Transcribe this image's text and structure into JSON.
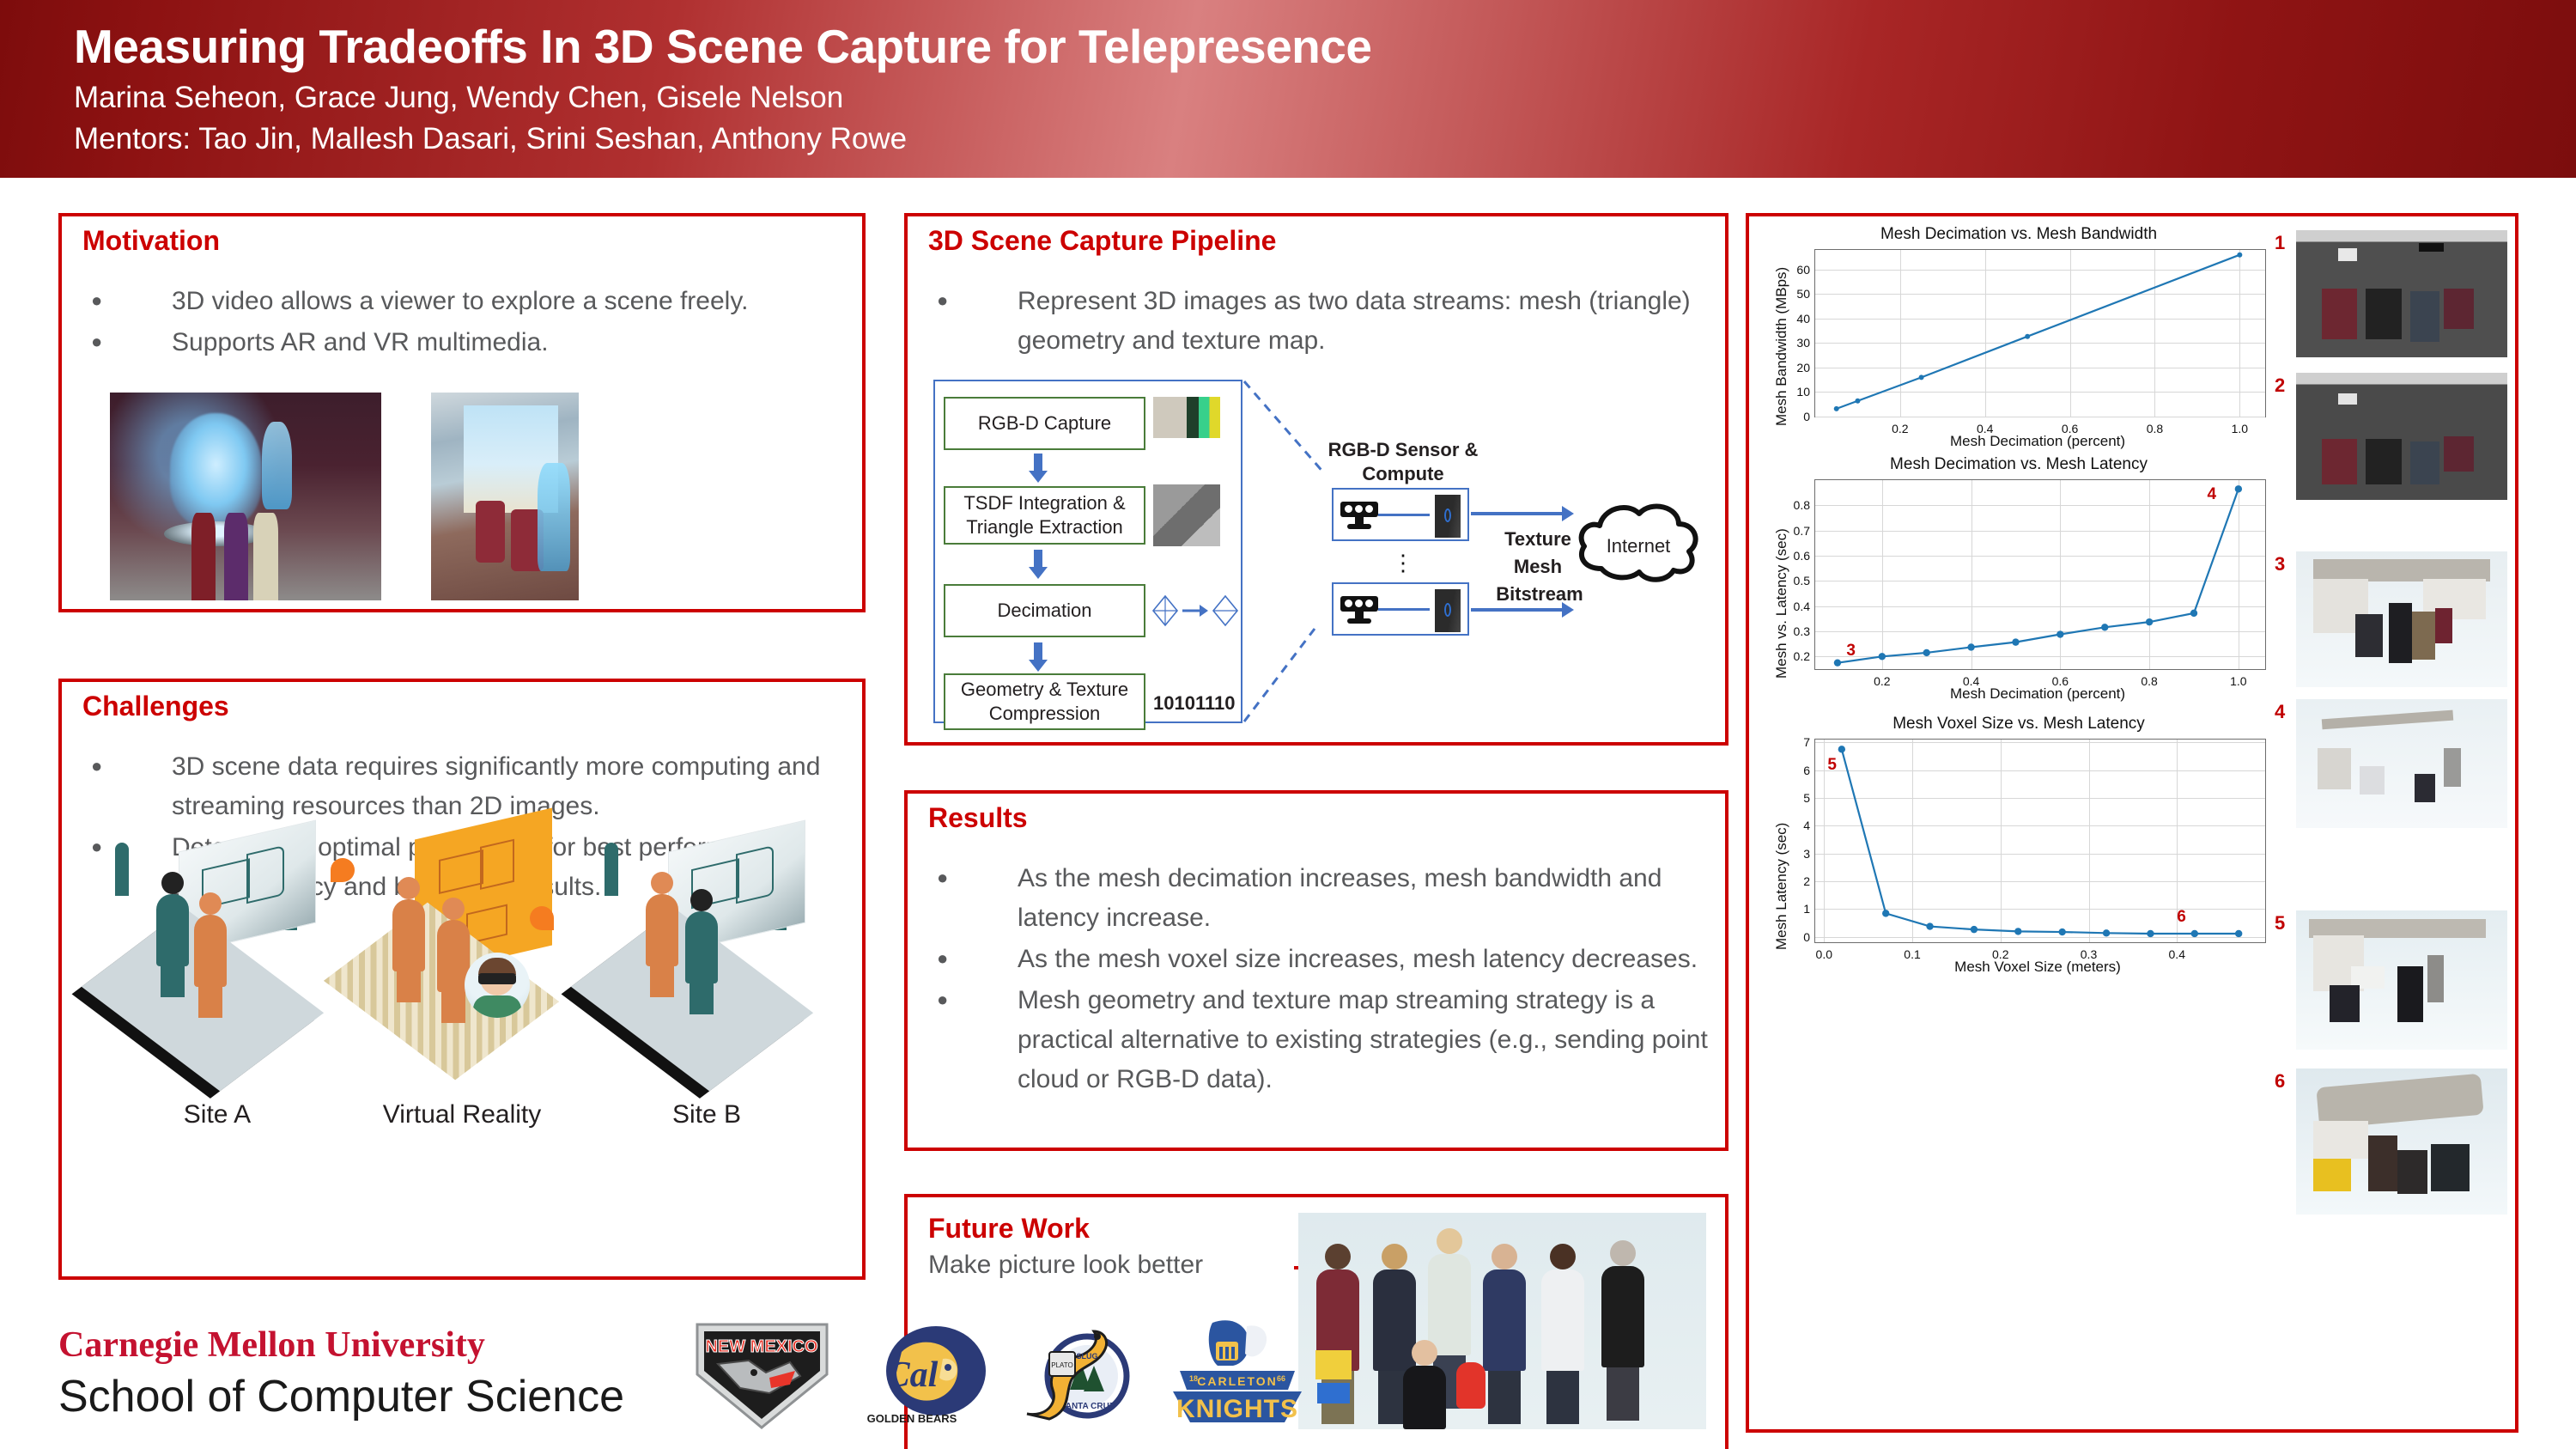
{
  "header": {
    "title": "Measuring Tradeoffs In 3D Scene Capture for Telepresence",
    "authors": "Marina Seheon, Grace Jung, Wendy Chen, Gisele Nelson",
    "mentors": "Mentors: Tao Jin, Mallesh Dasari, Srini Seshan, Anthony Rowe",
    "accent": "#cc0000",
    "gradient_from": "#7d0c0c",
    "gradient_to": "#d98080"
  },
  "motivation": {
    "title": "Motivation",
    "bullets": [
      "3D video allows a viewer to explore a scene freely.",
      "Supports AR and VR multimedia."
    ]
  },
  "challenges": {
    "title": "Challenges",
    "bullets": [
      "3D scene data requires significantly more computing and streaming resources than 2D images.",
      "Determining optimal parameters for best performance across latency and bandwidth results."
    ],
    "figure_labels": [
      "Site A",
      "Virtual Reality",
      "Site B"
    ]
  },
  "pipeline": {
    "title": "3D Scene Capture Pipeline",
    "bullets": [
      "Represent 3D images as two data streams: mesh (triangle) geometry and texture map."
    ],
    "steps": [
      "RGB-D Capture",
      "TSDF Integration & Triangle Extraction",
      "Decimation",
      "Geometry & Texture Compression"
    ],
    "bitstring": "10101110",
    "sensor_label": "RGB-D Sensor & Compute",
    "stream_label_1": "Texture",
    "stream_label_2": "Mesh",
    "stream_label_3": "Bitstream",
    "cloud_label": "Internet"
  },
  "results": {
    "title": "Results",
    "bullets": [
      "As the mesh decimation increases, mesh bandwidth and latency increase.",
      "As the mesh voxel size increases, mesh latency decreases.",
      "Mesh geometry and texture map streaming strategy is a practical alternative to existing strategies (e.g., sending point cloud or RGB-D data)."
    ]
  },
  "future_work": {
    "title": "Future Work",
    "text": "Make picture look better",
    "arrow": "right-arrow-icon"
  },
  "footer": {
    "cmu_line1": "Carnegie Mellon University",
    "cmu_line2": "School of Computer Science",
    "logos": [
      {
        "name": "new-mexico-lobos-logo",
        "caption": "NEW MEXICO"
      },
      {
        "name": "cal-golden-bears-logo",
        "caption": "GOLDEN BEARS",
        "word": "Cal"
      },
      {
        "name": "uc-santa-cruz-banana-slugs-logo",
        "caption": "SANTA CRUZ",
        "word": "SLUG"
      },
      {
        "name": "carleton-knights-logo",
        "caption": "KNIGHTS",
        "word": "CARLETON",
        "years": [
          "18",
          "66"
        ]
      }
    ]
  },
  "screenshots": [
    {
      "num": "1"
    },
    {
      "num": "2"
    },
    {
      "num": "3"
    },
    {
      "num": "4"
    },
    {
      "num": "5"
    },
    {
      "num": "6"
    }
  ],
  "chart_data": [
    {
      "type": "line",
      "title": "Mesh Decimation vs. Mesh Bandwidth",
      "xlabel": "Mesh Decimation (percent)",
      "ylabel": "Mesh Bandwidth (MBps)",
      "x": [
        0.05,
        0.1,
        0.25,
        0.5,
        1.0
      ],
      "values": [
        3.2,
        6.4,
        16.0,
        32.7,
        66.0
      ],
      "xlim": [
        0.0,
        1.06
      ],
      "ylim": [
        0,
        68
      ],
      "xticks": [
        "0.2",
        "0.4",
        "0.6",
        "0.8",
        "1.0"
      ],
      "xtick_vals": [
        0.2,
        0.4,
        0.6,
        0.8,
        1.0
      ],
      "yticks": [
        "0",
        "10",
        "20",
        "30",
        "40",
        "50",
        "60"
      ],
      "ytick_vals": [
        0,
        10,
        20,
        30,
        40,
        50,
        60
      ],
      "grid": true,
      "color": "#1f77b4",
      "annotations": []
    },
    {
      "type": "line",
      "title": "Mesh Decimation vs. Mesh Latency",
      "xlabel": "Mesh Decimation (percent)",
      "ylabel": "Mesh vs. Latency (sec)",
      "x": [
        0.1,
        0.2,
        0.3,
        0.4,
        0.5,
        0.6,
        0.7,
        0.8,
        0.9,
        1.0
      ],
      "values": [
        0.175,
        0.2,
        0.215,
        0.237,
        0.257,
        0.288,
        0.316,
        0.337,
        0.372,
        0.865
      ],
      "xlim": [
        0.05,
        1.06
      ],
      "ylim": [
        0.15,
        0.9
      ],
      "xticks": [
        "0.2",
        "0.4",
        "0.6",
        "0.8",
        "1.0"
      ],
      "xtick_vals": [
        0.2,
        0.4,
        0.6,
        0.8,
        1.0
      ],
      "yticks": [
        "0.2",
        "0.3",
        "0.4",
        "0.5",
        "0.6",
        "0.7",
        "0.8"
      ],
      "ytick_vals": [
        0.2,
        0.3,
        0.4,
        0.5,
        0.6,
        0.7,
        0.8
      ],
      "grid": true,
      "color": "#1f77b4",
      "annotations": [
        {
          "text": "3",
          "x": 0.12,
          "y": 0.225
        },
        {
          "text": "4",
          "x": 0.93,
          "y": 0.845
        }
      ]
    },
    {
      "type": "line",
      "title": "Mesh Voxel Size vs. Mesh Latency",
      "xlabel": "Mesh Voxel Size (meters)",
      "ylabel": "Mesh Latency (sec)",
      "x": [
        0.02,
        0.07,
        0.12,
        0.17,
        0.22,
        0.27,
        0.32,
        0.37,
        0.42,
        0.47
      ],
      "values": [
        6.75,
        0.84,
        0.37,
        0.26,
        0.19,
        0.17,
        0.13,
        0.11,
        0.11,
        0.11
      ],
      "xlim": [
        -0.01,
        0.5
      ],
      "ylim": [
        -0.2,
        7.1
      ],
      "xticks": [
        "0.0",
        "0.1",
        "0.2",
        "0.3",
        "0.4"
      ],
      "xtick_vals": [
        0.0,
        0.1,
        0.2,
        0.3,
        0.4
      ],
      "yticks": [
        "0",
        "1",
        "2",
        "3",
        "4",
        "5",
        "6",
        "7"
      ],
      "ytick_vals": [
        0,
        1,
        2,
        3,
        4,
        5,
        6,
        7
      ],
      "grid": true,
      "color": "#1f77b4",
      "annotations": [
        {
          "text": "5",
          "x": 0.004,
          "y": 6.2
        },
        {
          "text": "6",
          "x": 0.4,
          "y": 0.72
        }
      ]
    }
  ]
}
